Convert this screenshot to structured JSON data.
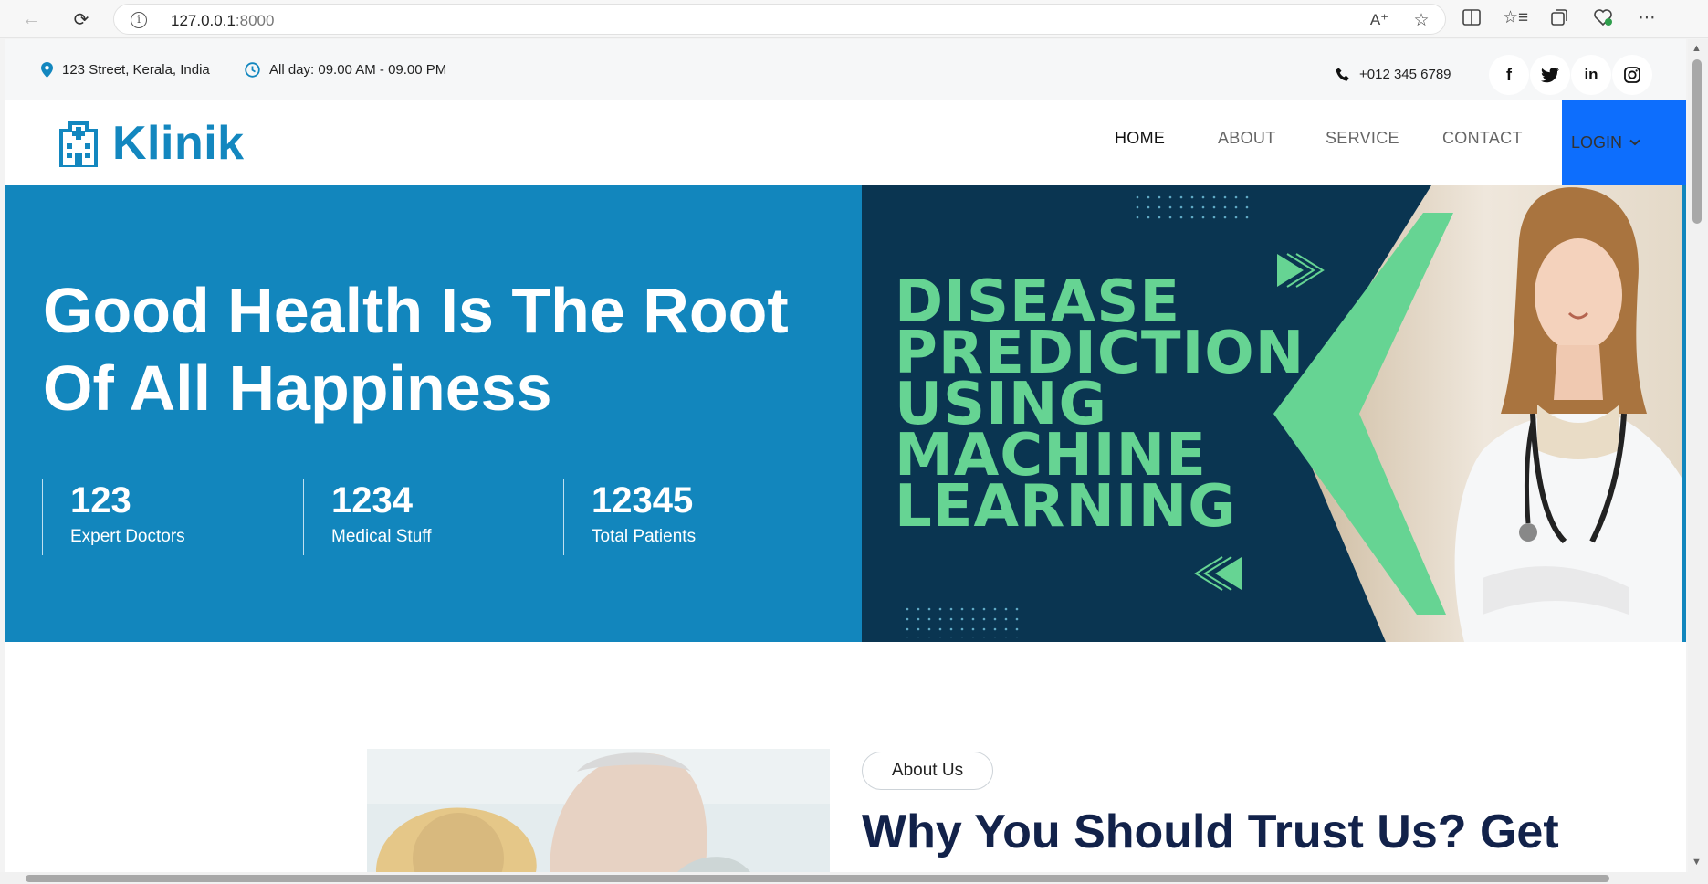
{
  "browser": {
    "url_host": "127.0.0.1",
    "url_port": ":8000"
  },
  "topbar": {
    "address": "123 Street, Kerala, India",
    "hours": "All day: 09.00 AM - 09.00 PM",
    "phone": "+012 345 6789",
    "socials": [
      "facebook",
      "twitter",
      "linkedin",
      "instagram"
    ]
  },
  "brand": {
    "name": "Klinik",
    "color": "#1387bf"
  },
  "nav": {
    "items": [
      {
        "label": "HOME",
        "active": true
      },
      {
        "label": "ABOUT"
      },
      {
        "label": "SERVICE"
      },
      {
        "label": "CONTACT"
      }
    ],
    "login": "LOGIN",
    "login_bg": "#0d6efd"
  },
  "hero": {
    "title_line1": "Good Health Is The Root",
    "title_line2": "Of All Happiness",
    "bg": "#1286bd",
    "stats": [
      {
        "value": "123",
        "label": "Expert Doctors"
      },
      {
        "value": "1234",
        "label": "Medical Stuff"
      },
      {
        "value": "12345",
        "label": "Total Patients"
      }
    ],
    "banner": {
      "lines": [
        "DISEASE",
        "PREDICTION",
        "USING",
        "MACHINE",
        "LEARNING"
      ],
      "bg": "#0a3551",
      "accent": "#66d493"
    }
  },
  "about": {
    "pill": "About Us",
    "title": "Why You Should Trust Us? Get"
  }
}
